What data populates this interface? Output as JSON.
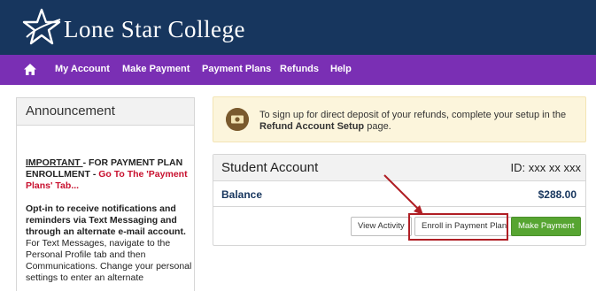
{
  "brand": {
    "name": "Lone Star College"
  },
  "nav": {
    "home_icon": "home-icon",
    "items": [
      "My Account",
      "Make Payment",
      "Payment Plans",
      "Refunds",
      "Help"
    ]
  },
  "announcement": {
    "title": "Announcement",
    "important_lead": "IMPORTANT ",
    "important_rest": "- FOR PAYMENT PLAN ENROLLMENT - ",
    "important_red": "Go To The 'Payment Plans' Tab...",
    "optin_bold": "Opt-in to receive notifications and reminders via Text Messaging and through an alternate e-mail account.",
    "optin_text": " For Text Messages, navigate to the Personal Profile tab and then Communications. Change your personal settings to enter an alternate"
  },
  "info": {
    "icon": "money-icon",
    "text_before": "To sign up for direct deposit of your refunds, complete your setup in the ",
    "link": "Refund Account Setup",
    "text_after": " page."
  },
  "account": {
    "title": "Student Account",
    "id_label": "ID: xxx xx xxx",
    "balance_label": "Balance",
    "balance_value": "$288.00",
    "buttons": {
      "view_activity": "View Activity",
      "enroll": "Enroll in Payment Plan",
      "make_payment": "Make Payment"
    }
  },
  "colors": {
    "header_bg": "#17365e",
    "nav_bg": "#7a2fb4",
    "accent_red": "#b01e24",
    "green_button": "#57a532"
  }
}
